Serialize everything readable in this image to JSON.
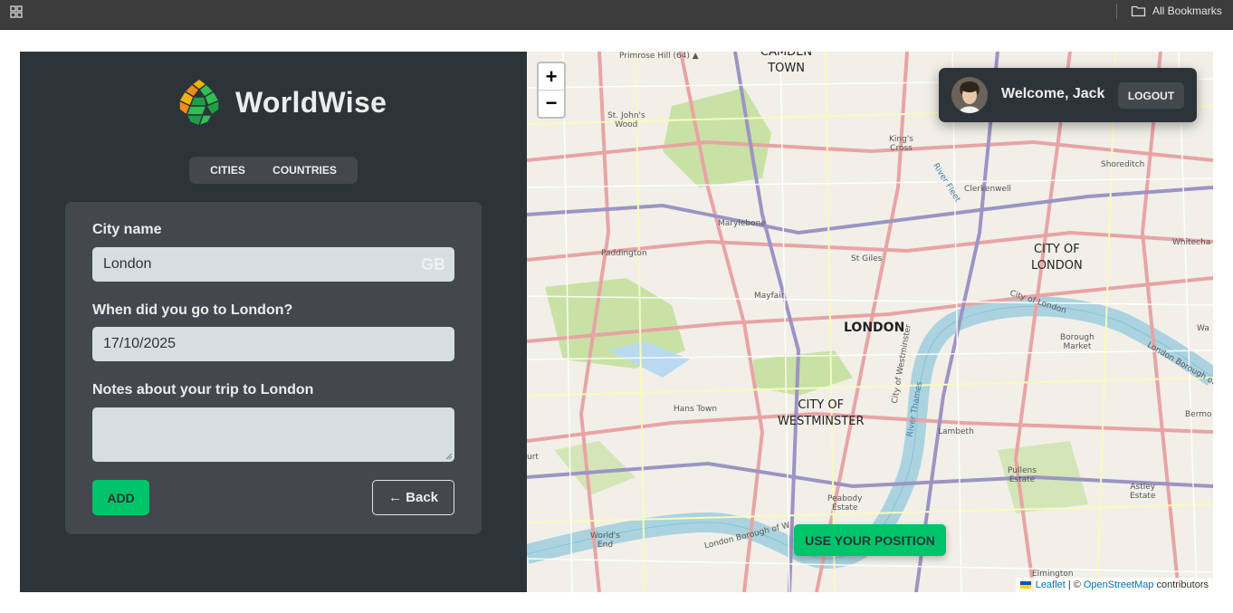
{
  "browser": {
    "apps_icon": "apps-grid-icon",
    "bookmarks_label": "All Bookmarks",
    "bookmarks_icon": "folder-icon"
  },
  "app": {
    "logo_text": "WorldWise",
    "tabs": [
      {
        "label": "Cities"
      },
      {
        "label": "Countries"
      }
    ],
    "form": {
      "city_label": "City name",
      "city_value": "London",
      "city_flag": "GB",
      "date_label": "When did you go to London?",
      "date_value": "17/10/2025",
      "notes_label": "Notes about your trip to London",
      "notes_value": "",
      "add_label": "Add",
      "back_label": "← Back"
    }
  },
  "map": {
    "zoom_in": "+",
    "zoom_out": "−",
    "user": {
      "welcome": "Welcome, Jack",
      "logout": "Logout"
    },
    "use_position_label": "Use your position",
    "attribution": {
      "leaflet": "Leaflet",
      "separator": "| ©",
      "osm": "OpenStreetMap",
      "suffix": "contributors"
    },
    "labels": {
      "camden": "CAMDEN\nTOWN",
      "primrose": "Primrose Hill (64) ▲",
      "stjohns": "St. John's\nWood",
      "kingscross": "King's\nCross",
      "shoreditch": "Shoreditch",
      "clerkenwell": "Clerkenwell",
      "marylebone": "Marylebone",
      "paddington": "Paddington",
      "stgiles": "St Giles",
      "cityoflondon": "CITY OF\nLONDON",
      "whitechapel": "Whitecha",
      "mayfair": "Mayfair",
      "london": "LONDON",
      "boroughmarket": "Borough\nMarket",
      "westminster": "CITY OF\nWESTMINSTER",
      "hanstown": "Hans Town",
      "lambeth": "Lambeth",
      "bermondsey": "Bermo",
      "pullens": "Pullens\nEstate",
      "astley": "Astley\nEstate",
      "peabody": "Peabody\nEstate",
      "worldsend": "World's\nEnd",
      "elmington": "Elmington",
      "riverfleet": "River Fleet",
      "cityoflondonriver": "City of London",
      "cityofwestminster_r": "City of Westminster",
      "rivertharmes": "River Thames",
      "lbborough": "London Borough of",
      "lbborough2": "London Borough of W",
      "wa": "Wa",
      "urt": "urt"
    }
  }
}
